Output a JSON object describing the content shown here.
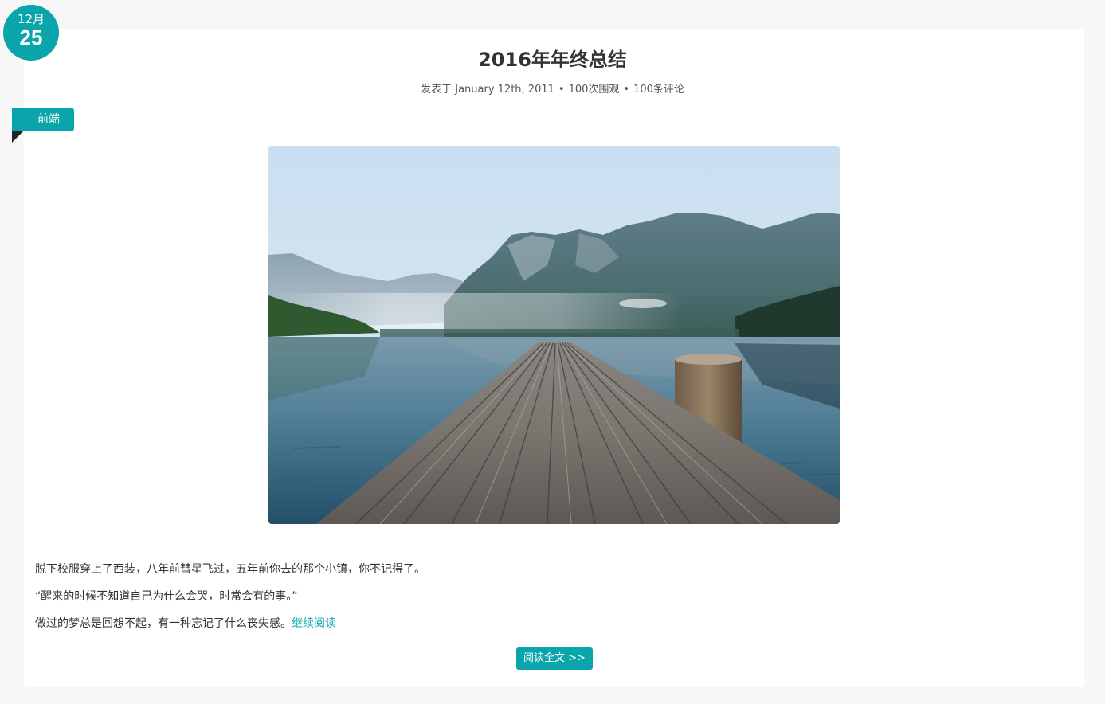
{
  "post": {
    "date": {
      "month": "12月",
      "day": "25"
    },
    "title": "2016年年终总结",
    "meta": {
      "prefix": "发表于",
      "date": "January 12th, 2011",
      "views": "100次围观",
      "comments": "100条评论",
      "separator": "•"
    },
    "category": "前端",
    "image": {
      "icon": "landscape-photo"
    },
    "excerpt": {
      "line1": "脱下校服穿上了西装，八年前彗星飞过，五年前你去的那个小镇，你不记得了。",
      "line2": "“醒来的时候不知道自己为什么会哭，时常会有的事。”",
      "line3": "做过的梦总是回想不起，有一种忘记了什么丧失感。",
      "continue_link": "继续阅读"
    },
    "read_full_button": "阅读全文 >>"
  },
  "colors": {
    "accent": "#0aa5aa",
    "background": "#f7f7f7",
    "card": "#ffffff",
    "text": "#333333"
  }
}
